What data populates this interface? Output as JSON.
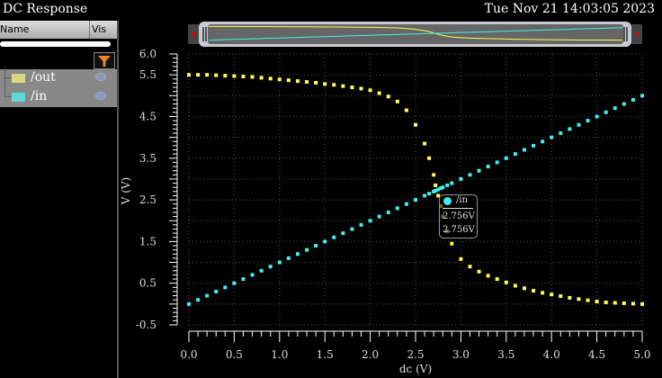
{
  "window": {
    "title": "DC Response",
    "datetime": "Tue Nov 21 14:03:05 2023"
  },
  "panel": {
    "col_name": "Name",
    "col_vis": "Vis",
    "filter_icon": "funnel-icon",
    "signals": [
      {
        "name": "/out",
        "color": "#d8d880",
        "visible": true
      },
      {
        "name": "/in",
        "color": "#60d8d8",
        "visible": true
      }
    ]
  },
  "colors": {
    "out": "#ffff55",
    "in": "#44eeee"
  },
  "tooltip": {
    "signal": "/in",
    "x_value": "2.756V",
    "y_value": "2.756V"
  },
  "chart_data": {
    "type": "scatter",
    "xlabel": "dc (V)",
    "ylabel": "V (V)",
    "xlim": [
      0,
      5
    ],
    "ylim": [
      -0.5,
      6
    ],
    "xticks": [
      "0.0",
      "0.5",
      "1.0",
      "1.5",
      "2.0",
      "2.5",
      "3.0",
      "3.5",
      "4.0",
      "4.5",
      "5.0"
    ],
    "yticks": [
      "6.0",
      "5.5",
      "4.5",
      "3.5",
      "2.5",
      "1.5",
      "0.5",
      "-0.5"
    ],
    "grid": true,
    "x": [
      0,
      0.1,
      0.2,
      0.3,
      0.4,
      0.5,
      0.6,
      0.7,
      0.8,
      0.9,
      1.0,
      1.1,
      1.2,
      1.3,
      1.4,
      1.5,
      1.6,
      1.7,
      1.8,
      1.9,
      2.0,
      2.1,
      2.2,
      2.3,
      2.4,
      2.5,
      2.6,
      2.65,
      2.7,
      2.72,
      2.75,
      2.78,
      2.8,
      2.85,
      2.9,
      3.0,
      3.1,
      3.2,
      3.3,
      3.4,
      3.5,
      3.6,
      3.7,
      3.8,
      3.9,
      4.0,
      4.1,
      4.2,
      4.3,
      4.4,
      4.5,
      4.6,
      4.7,
      4.8,
      4.9,
      5.0
    ],
    "series": [
      {
        "name": "/out",
        "values": [
          5.5,
          5.5,
          5.5,
          5.49,
          5.48,
          5.47,
          5.46,
          5.45,
          5.43,
          5.41,
          5.39,
          5.37,
          5.35,
          5.33,
          5.31,
          5.28,
          5.26,
          5.23,
          5.2,
          5.17,
          5.13,
          5.06,
          4.98,
          4.86,
          4.65,
          4.3,
          3.85,
          3.5,
          3.1,
          2.85,
          2.6,
          2.35,
          2.1,
          1.75,
          1.45,
          1.08,
          0.9,
          0.78,
          0.68,
          0.6,
          0.52,
          0.44,
          0.38,
          0.32,
          0.27,
          0.23,
          0.19,
          0.15,
          0.12,
          0.09,
          0.06,
          0.04,
          0.03,
          0.02,
          0.01,
          0.0
        ]
      },
      {
        "name": "/in",
        "values": [
          0,
          0.1,
          0.2,
          0.3,
          0.4,
          0.5,
          0.6,
          0.7,
          0.8,
          0.9,
          1.0,
          1.1,
          1.2,
          1.3,
          1.4,
          1.5,
          1.6,
          1.7,
          1.8,
          1.9,
          2.0,
          2.1,
          2.2,
          2.3,
          2.4,
          2.5,
          2.6,
          2.65,
          2.7,
          2.72,
          2.75,
          2.78,
          2.8,
          2.85,
          2.9,
          3.0,
          3.1,
          3.2,
          3.3,
          3.4,
          3.5,
          3.6,
          3.7,
          3.8,
          3.9,
          4.0,
          4.1,
          4.2,
          4.3,
          4.4,
          4.5,
          4.6,
          4.7,
          4.8,
          4.9,
          5.0
        ]
      }
    ]
  }
}
